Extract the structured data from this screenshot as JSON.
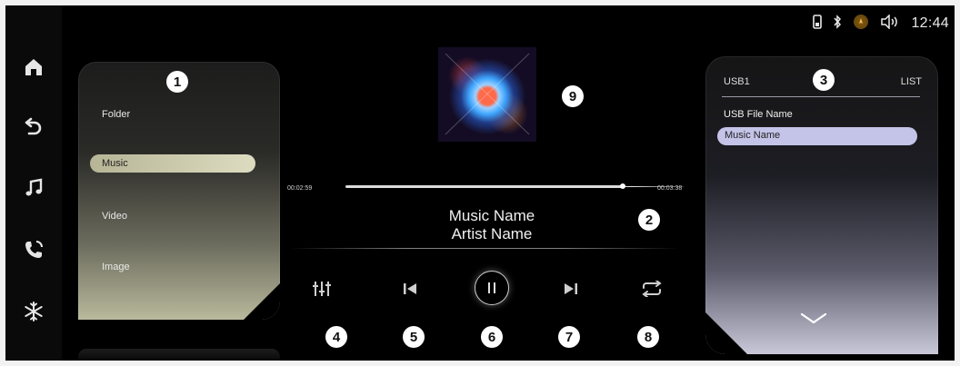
{
  "status_bar": {
    "clock": "12:44",
    "icons": [
      "phone-icon",
      "bluetooth-icon",
      "navigation-icon",
      "volume-icon"
    ],
    "accent_color": "#c58a1c"
  },
  "nav": {
    "items": [
      {
        "name": "home-icon"
      },
      {
        "name": "back-icon"
      },
      {
        "name": "music-icon"
      },
      {
        "name": "phone-call-icon"
      },
      {
        "name": "climate-icon"
      }
    ]
  },
  "left_panel": {
    "items": [
      "Folder",
      "Music",
      "Video",
      "Image"
    ],
    "selected": "Music",
    "highlight_color": "#cfcdb0"
  },
  "right_panel": {
    "header_left": "USB1",
    "header_right": "LIST",
    "items": [
      "USB File Name",
      "Music Name"
    ],
    "selected": "Music Name",
    "highlight_color": "#c4c3e8"
  },
  "player": {
    "elapsed": "00:02:59",
    "total": "00:03:38",
    "progress": 0.82,
    "title": "Music Name",
    "artist": "Artist Name",
    "controls": [
      "equalizer-icon",
      "previous-icon",
      "pause-icon",
      "next-icon",
      "repeat-icon"
    ]
  },
  "callouts": {
    "n1": "1",
    "n2": "2",
    "n3": "3",
    "n4": "4",
    "n5": "5",
    "n6": "6",
    "n7": "7",
    "n8": "8",
    "n9": "9"
  }
}
